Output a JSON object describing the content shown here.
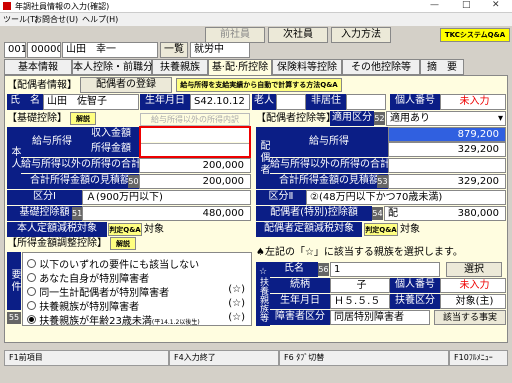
{
  "window": {
    "title": "年調社員情報の入力(確認)",
    "min": "—",
    "max": "□",
    "close": "✕"
  },
  "menu": [
    "ツール(T)",
    "お問合せ(U)",
    "ヘルプ(H)"
  ],
  "toolbar": {
    "prev": "前社員",
    "next": "次社員",
    "method": "入力方法",
    "qa": "TKCシステムQ&A"
  },
  "employee": {
    "code1": "001",
    "code2": "000001",
    "name": "山田　幸一",
    "list_btn": "一覧",
    "status": "就労中"
  },
  "tabs": [
    "基本情報",
    "本人控除・前職分",
    "扶養親族",
    "基·配·所控除",
    "保険料等控除",
    "その他控除等",
    "摘　要"
  ],
  "spouse_info": {
    "header": "【配偶者情報】",
    "register_btn": "配偶者の登録",
    "auto_calc": "給与所得を支給実績から自動で計算する方法Q&A",
    "name_label": "氏　名",
    "name_value": "山田　佐智子",
    "dob_label": "生年月日",
    "dob_value": "S42.10.12",
    "elder_label": "老人",
    "nonres_label": "非居住",
    "mynum_label": "個人番号",
    "mynum_value": "未入力"
  },
  "basic_deduction": {
    "header": "【基礎控除】",
    "explain_btn": "解説",
    "hint": "給与所得以外の所得内訳",
    "side": "本人",
    "salary_income": "給与所得",
    "income_amt": "収入金額",
    "income_val": "",
    "salary_amt": "所得金額",
    "salary_val": "",
    "other_income": "給与所得以外の所得の合計",
    "other_val": "200,000",
    "total_est": "合計所得金額の見積額",
    "total_num": "50",
    "total_val": "200,000",
    "category": "区分Ⅰ",
    "category_val": "Ａ(900万円以下)",
    "amount": "基礎控除額",
    "amount_num": "51",
    "amount_val": "480,000",
    "spouse_target": "本人定額減税対象",
    "target_q": "判定Q&A",
    "target_val": "対象"
  },
  "spouse_deduction": {
    "header": "【配偶者控除等】",
    "apply_label": "適用区分",
    "apply_num": "52",
    "apply_val": "適用あり",
    "side": "配偶者",
    "salary_income": "給与所得",
    "income_val": "879,200",
    "salary_val": "329,200",
    "other_income": "給与所得以外の所得の合計",
    "other_val": "",
    "total_est": "合計所得金額の見積額",
    "total_num": "53",
    "total_val": "329,200",
    "category": "区分Ⅱ",
    "category_val": "②(48万円以下かつ70歳未満)",
    "amount": "配偶者(特別)控除額",
    "amount_num": "54",
    "amount_prefix": "配",
    "amount_val": "380,000",
    "target": "配偶者定額減税対象",
    "target_q": "判定Q&A",
    "target_val": "対象"
  },
  "adjustment": {
    "header": "【所得金額調整控除】",
    "explain_btn": "解説",
    "side": "要件",
    "side_num": "55",
    "options": [
      {
        "label": "以下のいずれの要件にも該当しない",
        "mark": "",
        "on": false
      },
      {
        "label": "あなた自身が特別障害者",
        "mark": "",
        "on": false
      },
      {
        "label": "同一生計配偶者が特別障害者",
        "mark": "(☆)",
        "on": false
      },
      {
        "label": "扶養親族が特別障害者",
        "mark": "(☆)",
        "on": false
      },
      {
        "label": "扶養親族が年齢23歳未満",
        "sub": "(平14.1.2以後生)",
        "mark": "(☆)",
        "on": true
      }
    ]
  },
  "dependent": {
    "note": "♠左記の「☆」に該当する親族を選択します。",
    "side": "☆扶養親族等",
    "name_label": "氏名",
    "name_num": "56",
    "name_val": "1",
    "select_btn": "選択",
    "rel_label": "続柄",
    "rel_val": "子",
    "mynum_label": "個人番号",
    "mynum_val": "未入力",
    "dob_label": "生年月日",
    "dob_val": "Ｈ５.５.５",
    "dep_label": "扶養区分",
    "dep_val": "対象(主)",
    "dis_label": "障害者区分",
    "dis_val": "同居特別障害者",
    "fact_btn": "該当する事実"
  },
  "fkeys": [
    "F1前項目",
    "F4入力終了",
    "F6 ﾀﾌﾞ切替",
    "F10ﾌﾙﾒﾆｭｰ"
  ]
}
